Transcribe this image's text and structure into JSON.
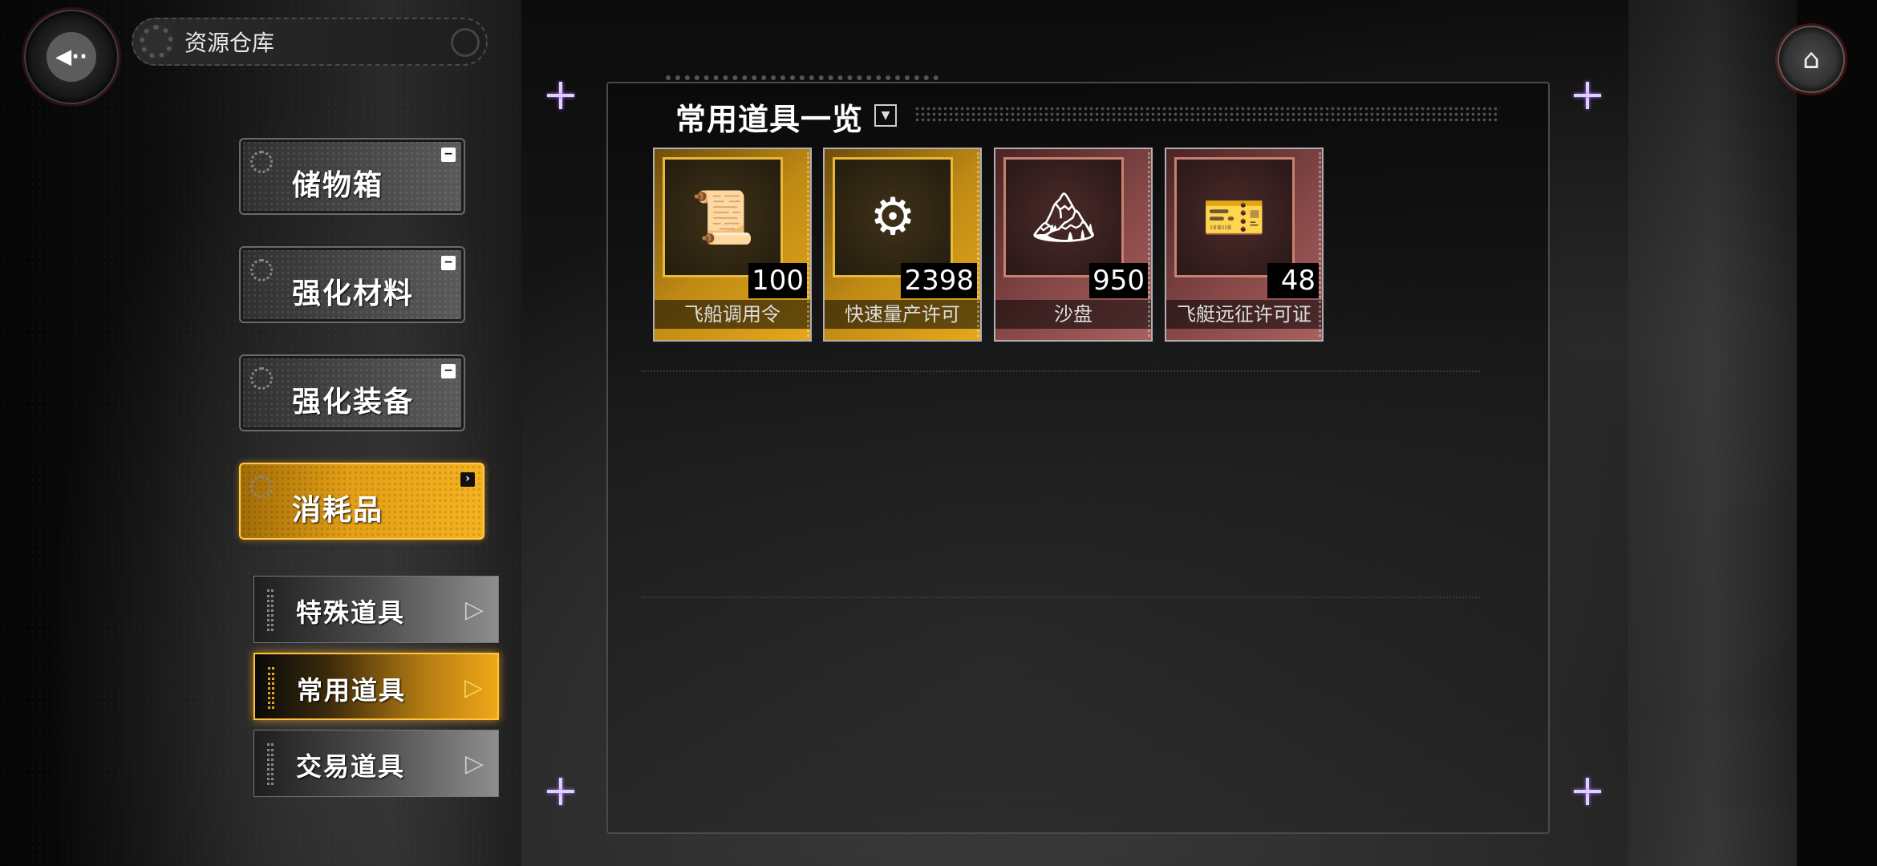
{
  "header": {
    "title": "资源仓库",
    "back_icon": "back-arrow-icon",
    "home_icon": "home-icon"
  },
  "categories": [
    {
      "label": "储物箱",
      "indicator": "−",
      "active": false
    },
    {
      "label": "强化材料",
      "indicator": "−",
      "active": false
    },
    {
      "label": "强化装备",
      "indicator": "−",
      "active": false
    },
    {
      "label": "消耗品",
      "indicator": "›",
      "active": true
    }
  ],
  "subcategories": [
    {
      "label": "特殊道具",
      "active": false
    },
    {
      "label": "常用道具",
      "active": true
    },
    {
      "label": "交易道具",
      "active": false
    }
  ],
  "panel": {
    "heading": "常用道具一览",
    "dropdown_icon": "▼"
  },
  "items": [
    {
      "name": "飞船调用令",
      "count": "100",
      "rarity": "gold",
      "icon": "📜"
    },
    {
      "name": "快速量产许可",
      "count": "2398",
      "rarity": "gold",
      "icon": "⚙"
    },
    {
      "name": "沙盘",
      "count": "950",
      "rarity": "red",
      "icon": "🏔"
    },
    {
      "name": "飞艇远征许可证",
      "count": "48",
      "rarity": "red",
      "icon": "🎫"
    }
  ],
  "colors": {
    "accent_gold": "#e4a016",
    "accent_red": "#8a4a4a",
    "panel_border": "#4a4a4a"
  }
}
